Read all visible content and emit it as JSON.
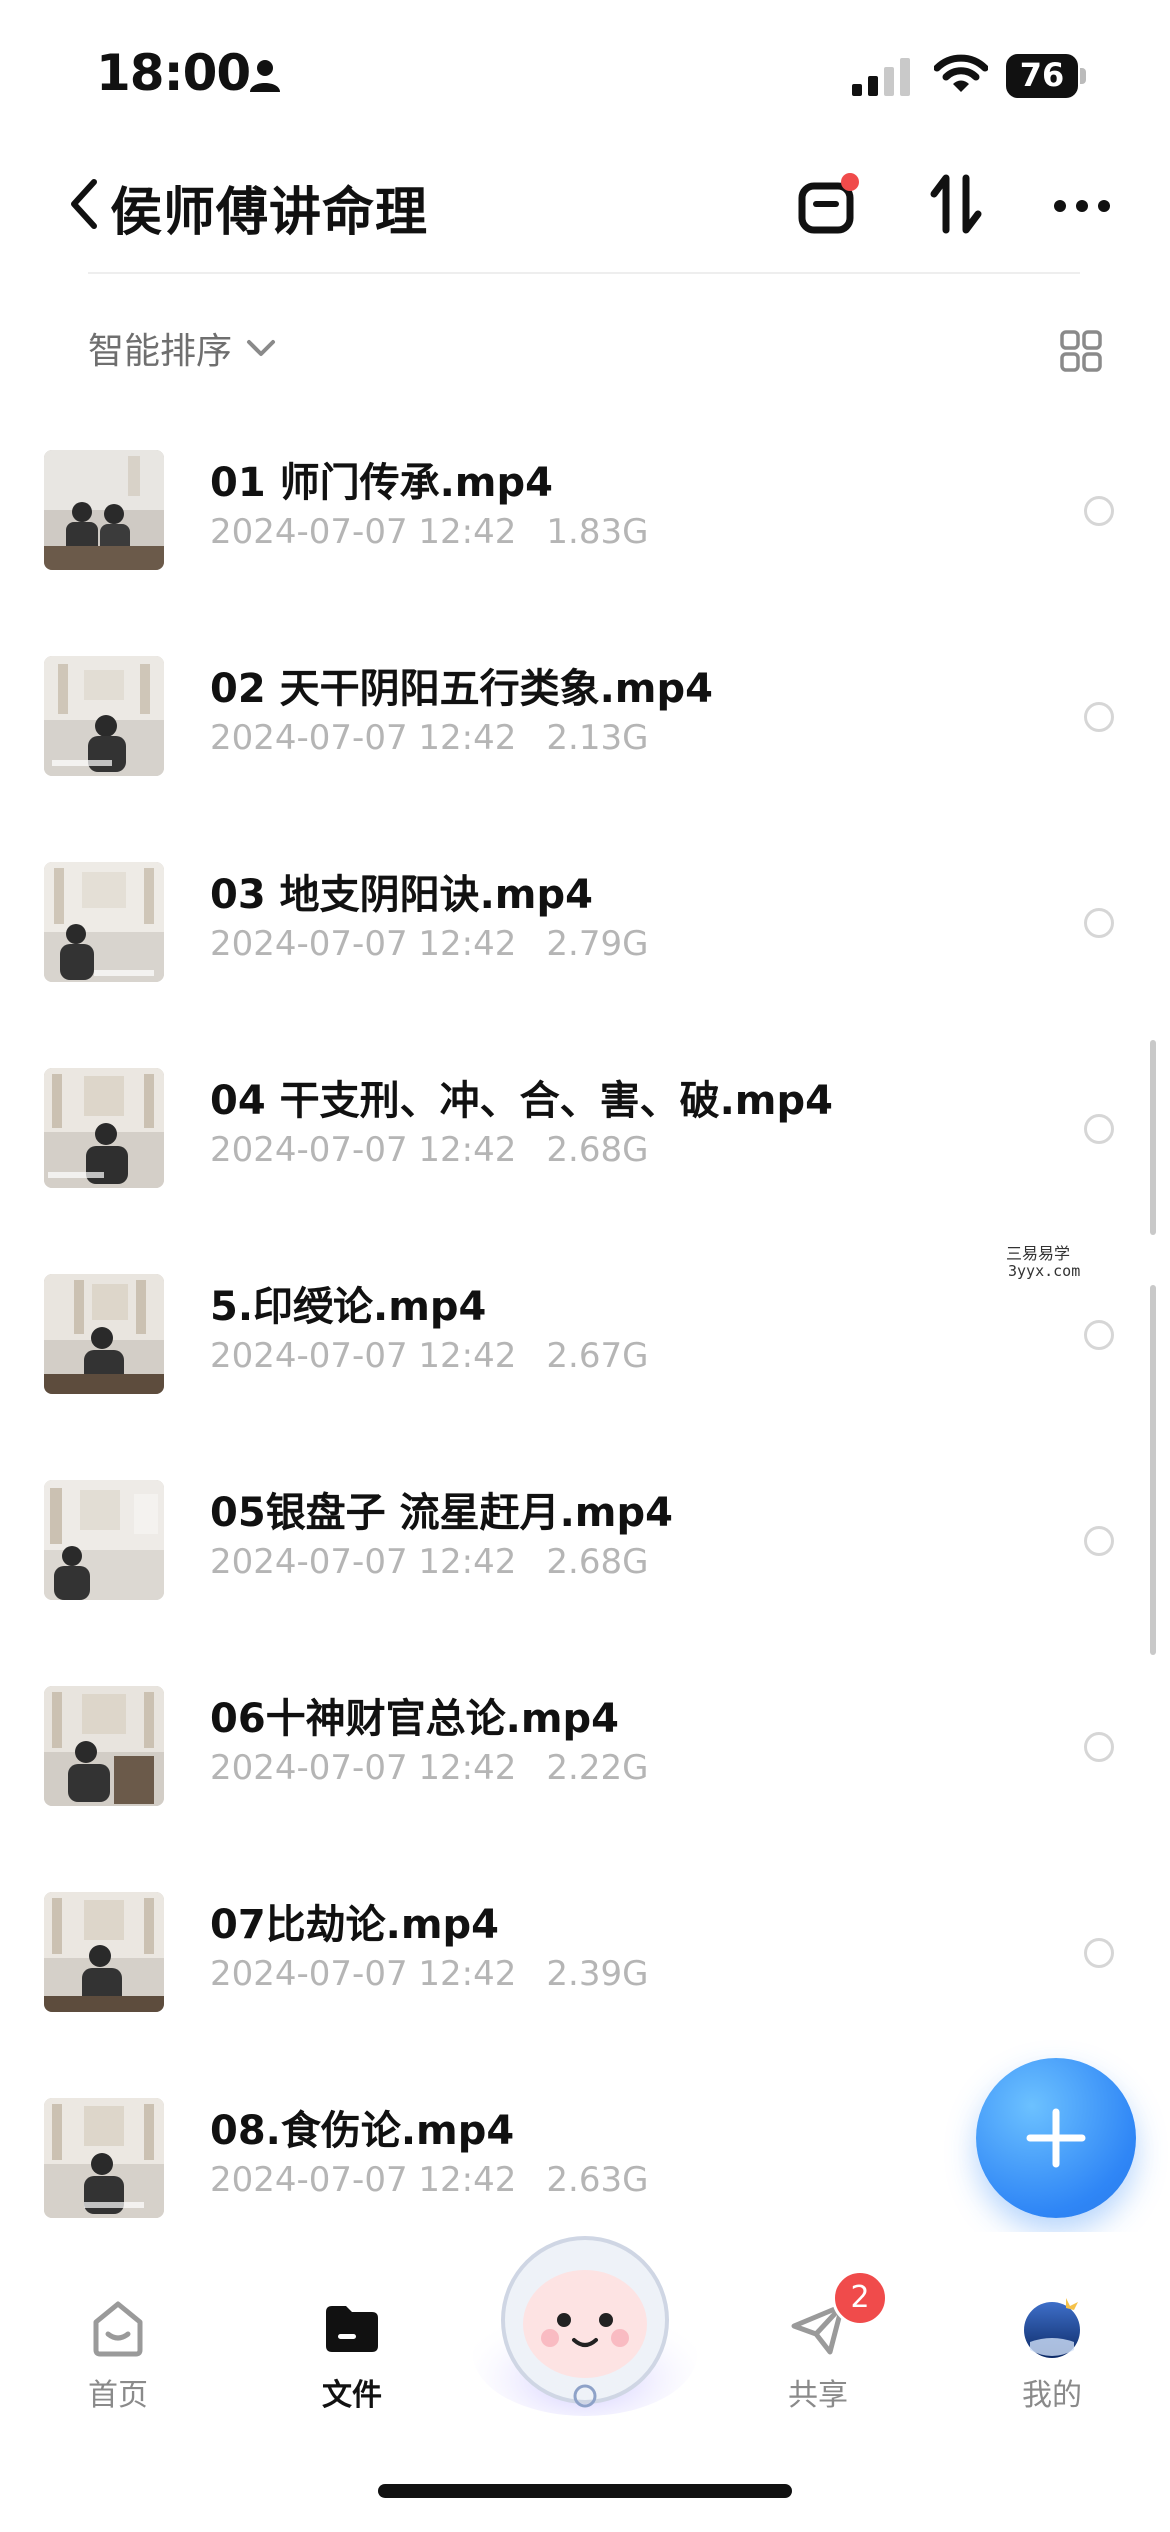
{
  "status_bar": {
    "time": "18:00",
    "battery": "76"
  },
  "header": {
    "title": "侯师傅讲命理"
  },
  "sort_bar": {
    "label": "智能排序"
  },
  "files": [
    {
      "name": "01 师门传承.mp4",
      "date": "2024-07-07 12:42",
      "size": "1.83G"
    },
    {
      "name": "02 天干阴阳五行类象.mp4",
      "date": "2024-07-07 12:42",
      "size": "2.13G"
    },
    {
      "name": "03 地支阴阳诀.mp4",
      "date": "2024-07-07 12:42",
      "size": "2.79G"
    },
    {
      "name": "04 干支刑、冲、合、害、破.mp4",
      "date": "2024-07-07 12:42",
      "size": "2.68G"
    },
    {
      "name": "5.印绶论.mp4",
      "date": "2024-07-07 12:42",
      "size": "2.67G"
    },
    {
      "name": "05银盘子 流星赶月.mp4",
      "date": "2024-07-07 12:42",
      "size": "2.68G"
    },
    {
      "name": "06十神财官总论.mp4",
      "date": "2024-07-07 12:42",
      "size": "2.22G"
    },
    {
      "name": "07比劫论.mp4",
      "date": "2024-07-07 12:42",
      "size": "2.39G"
    },
    {
      "name": "08.食伤论.mp4",
      "date": "2024-07-07 12:42",
      "size": "2.63G"
    }
  ],
  "watermark": {
    "line1": "三易易学",
    "line2": "3yyx.com"
  },
  "tabbar": {
    "home": "首页",
    "files": "文件",
    "share": "共享",
    "share_badge": "2",
    "me": "我的"
  },
  "colors": {
    "accent": "#2f86f6",
    "badge": "#f04b4b",
    "meta_text": "#b5b5b5"
  },
  "icons": [
    "person-icon",
    "signal-icon",
    "wifi-icon",
    "battery-icon",
    "back-icon",
    "transfer-icon",
    "sort-order-icon",
    "more-icon",
    "chevron-down-icon",
    "grid-view-icon",
    "plus-icon",
    "home-icon",
    "folder-icon",
    "share-icon",
    "avatar-icon"
  ]
}
